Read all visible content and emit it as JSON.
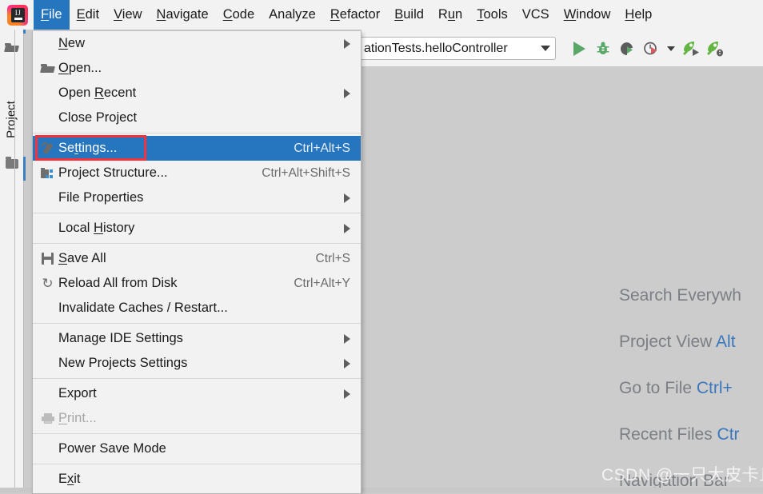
{
  "window": {
    "logo_alt": "intellij-idea-logo"
  },
  "menubar": {
    "items": [
      {
        "label": "File",
        "mnemonic": "F",
        "active": true
      },
      {
        "label": "Edit",
        "mnemonic": "E",
        "active": false
      },
      {
        "label": "View",
        "mnemonic": "V",
        "active": false
      },
      {
        "label": "Navigate",
        "mnemonic": "N",
        "active": false
      },
      {
        "label": "Code",
        "mnemonic": "C",
        "active": false
      },
      {
        "label": "Analyze",
        "mnemonic": "",
        "active": false
      },
      {
        "label": "Refactor",
        "mnemonic": "R",
        "active": false
      },
      {
        "label": "Build",
        "mnemonic": "B",
        "active": false
      },
      {
        "label": "Run",
        "mnemonic": "u",
        "active": false
      },
      {
        "label": "Tools",
        "mnemonic": "T",
        "active": false
      },
      {
        "label": "VCS",
        "mnemonic": "",
        "active": false
      },
      {
        "label": "Window",
        "mnemonic": "W",
        "active": false
      },
      {
        "label": "Help",
        "mnemonic": "H",
        "active": false
      }
    ]
  },
  "file_menu": {
    "items": [
      {
        "label": "New",
        "accel": "",
        "arrow": true,
        "icon": "",
        "state": "normal"
      },
      {
        "label": "Open...",
        "accel": "",
        "arrow": false,
        "icon": "folder-open-icon",
        "state": "normal"
      },
      {
        "label": "Open Recent",
        "accel": "",
        "arrow": true,
        "icon": "",
        "state": "normal"
      },
      {
        "label": "Close Project",
        "accel": "",
        "arrow": false,
        "icon": "",
        "state": "normal"
      },
      {
        "separator": true
      },
      {
        "label": "Settings...",
        "accel": "Ctrl+Alt+S",
        "arrow": false,
        "icon": "wrench-icon",
        "state": "selected"
      },
      {
        "label": "Project Structure...",
        "accel": "Ctrl+Alt+Shift+S",
        "arrow": false,
        "icon": "project-structure-icon",
        "state": "normal"
      },
      {
        "label": "File Properties",
        "accel": "",
        "arrow": true,
        "icon": "",
        "state": "normal"
      },
      {
        "separator": true
      },
      {
        "label": "Local History",
        "accel": "",
        "arrow": true,
        "icon": "",
        "state": "normal"
      },
      {
        "separator": true
      },
      {
        "label": "Save All",
        "accel": "Ctrl+S",
        "arrow": false,
        "icon": "save-icon",
        "state": "normal"
      },
      {
        "label": "Reload All from Disk",
        "accel": "Ctrl+Alt+Y",
        "arrow": false,
        "icon": "reload-icon",
        "state": "normal"
      },
      {
        "label": "Invalidate Caches / Restart...",
        "accel": "",
        "arrow": false,
        "icon": "",
        "state": "normal"
      },
      {
        "separator": true
      },
      {
        "label": "Manage IDE Settings",
        "accel": "",
        "arrow": true,
        "icon": "",
        "state": "normal"
      },
      {
        "label": "New Projects Settings",
        "accel": "",
        "arrow": true,
        "icon": "",
        "state": "normal"
      },
      {
        "separator": true
      },
      {
        "label": "Export",
        "accel": "",
        "arrow": true,
        "icon": "",
        "state": "normal"
      },
      {
        "label": "Print...",
        "accel": "",
        "arrow": false,
        "icon": "print-icon",
        "state": "disabled"
      },
      {
        "separator": true
      },
      {
        "label": "Power Save Mode",
        "accel": "",
        "arrow": false,
        "icon": "",
        "state": "normal"
      },
      {
        "separator": true
      },
      {
        "label": "Exit",
        "accel": "",
        "arrow": false,
        "icon": "",
        "state": "normal"
      }
    ],
    "mnemonics": {
      "New": "N",
      "Open...": "O",
      "Open Recent": "R",
      "Settings...": "t",
      "Local History": "H",
      "Save All": "S",
      "Print...": "P",
      "Exit": "x"
    }
  },
  "left_stripe": {
    "project_tab_label": "Project",
    "top_icon": "folder-open-icon",
    "bottom_icon": "folder-icon"
  },
  "toolbar": {
    "run_config_label": "ationTests.helloController",
    "icons": [
      "run-icon",
      "debug-icon",
      "run-with-coverage-icon",
      "profiler-icon",
      "profiler-dropdown-icon",
      "rocket-run-icon",
      "rocket-debug-icon"
    ]
  },
  "editor_hints": [
    {
      "text": "Search Everywh",
      "key": ""
    },
    {
      "text": "Project View ",
      "key": "Alt"
    },
    {
      "text": "Go to File ",
      "key": "Ctrl+"
    },
    {
      "text": "Recent Files ",
      "key": "Ctr"
    },
    {
      "text": "Navigation Bar",
      "key": ""
    }
  ],
  "annotation": {
    "color": "#f5333f",
    "targets": "settings-menu-item"
  },
  "watermark": {
    "text": "CSDN @一只大皮卡丘"
  },
  "colors": {
    "menu_bg": "#f2f2f2",
    "selection_blue": "#2675bf",
    "editor_bg": "#cccccc",
    "accent_blue": "#3b7fc4",
    "hint_text": "#7b7f85",
    "hint_key": "#3b77bd"
  }
}
